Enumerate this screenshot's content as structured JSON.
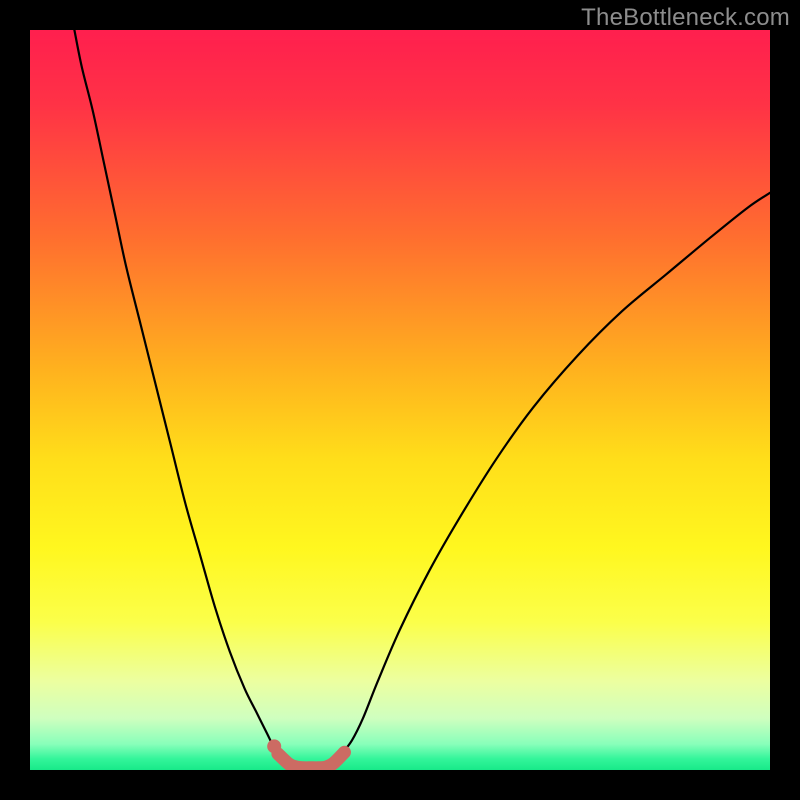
{
  "watermark": {
    "text": "TheBottleneck.com"
  },
  "colors": {
    "black": "#000000",
    "curve": "#000000",
    "marker": "#c1645c",
    "marker_fill": "#cc6b63"
  },
  "chart_data": {
    "type": "line",
    "title": "",
    "xlabel": "",
    "ylabel": "",
    "xlim": [
      0,
      100
    ],
    "ylim": [
      0,
      100
    ],
    "gradient_stops": [
      {
        "offset": 0.0,
        "color": "#ff1f4e"
      },
      {
        "offset": 0.1,
        "color": "#ff3246"
      },
      {
        "offset": 0.28,
        "color": "#ff6e2f"
      },
      {
        "offset": 0.46,
        "color": "#ffb21e"
      },
      {
        "offset": 0.58,
        "color": "#ffde1a"
      },
      {
        "offset": 0.7,
        "color": "#fff71f"
      },
      {
        "offset": 0.8,
        "color": "#fbff4a"
      },
      {
        "offset": 0.88,
        "color": "#ecffa0"
      },
      {
        "offset": 0.93,
        "color": "#cfffbf"
      },
      {
        "offset": 0.965,
        "color": "#88ffba"
      },
      {
        "offset": 0.985,
        "color": "#33f59a"
      },
      {
        "offset": 1.0,
        "color": "#18e989"
      }
    ],
    "series": [
      {
        "name": "left-curve",
        "x": [
          6.0,
          7.0,
          8.5,
          10.0,
          11.5,
          13.0,
          15.0,
          17.0,
          19.0,
          21.0,
          23.0,
          25.0,
          27.0,
          29.0,
          30.5,
          32.0,
          33.0,
          34.0,
          35.0
        ],
        "y": [
          100,
          95,
          89,
          82,
          75,
          68,
          60,
          52,
          44,
          36,
          29,
          22,
          16,
          11,
          8,
          5,
          3,
          1.5,
          0.5
        ]
      },
      {
        "name": "right-curve",
        "x": [
          41.0,
          42.0,
          43.5,
          45.0,
          47.0,
          50.0,
          54.0,
          58.0,
          63.0,
          68.0,
          74.0,
          80.0,
          86.0,
          92.0,
          97.0,
          100.0
        ],
        "y": [
          0.5,
          2,
          4,
          7,
          12,
          19,
          27,
          34,
          42,
          49,
          56,
          62,
          67,
          72,
          76,
          78
        ]
      },
      {
        "name": "flat-bottom-marker",
        "x": [
          33.5,
          35.0,
          36.0,
          37.0,
          38.0,
          39.0,
          40.0,
          41.0,
          42.5
        ],
        "y": [
          2.2,
          0.8,
          0.4,
          0.3,
          0.3,
          0.3,
          0.4,
          0.9,
          2.4
        ]
      }
    ],
    "markers": [
      {
        "name": "dot-left",
        "x": 33.0,
        "y": 3.2
      }
    ]
  }
}
